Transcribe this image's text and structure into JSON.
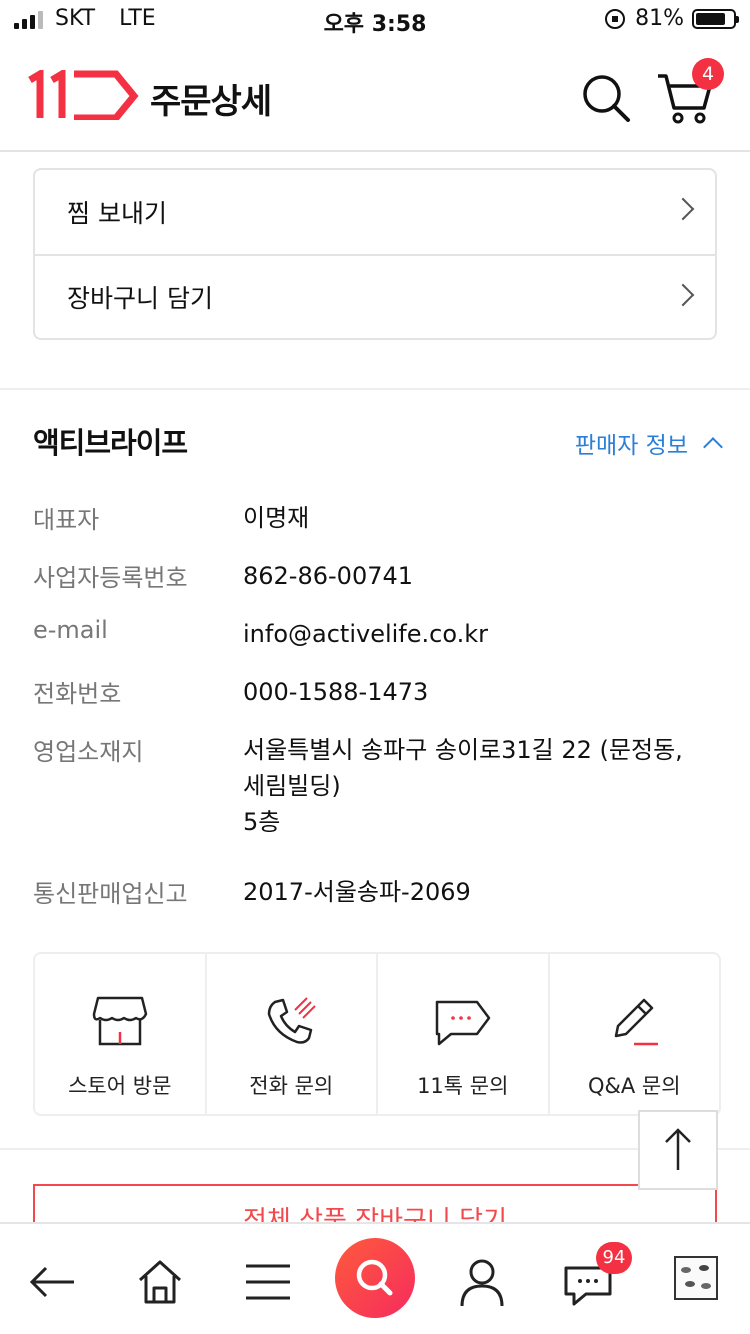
{
  "status_bar": {
    "carrier": "SKT",
    "network": "LTE",
    "time": "오후 3:58",
    "battery": "81%",
    "battery_level": 0.81
  },
  "header": {
    "title": "주문상세",
    "cart_count": "4",
    "brand_color": "#f43142"
  },
  "actions": [
    {
      "label": "찜 보내기"
    },
    {
      "label": "장바구니 담기"
    }
  ],
  "seller": {
    "name": "액티브라이프",
    "toggle_label": "판매자 정보",
    "fields": [
      {
        "label": "대표자",
        "value": "이명재"
      },
      {
        "label": "사업자등록번호",
        "value": "862-86-00741"
      },
      {
        "label": "e-mail",
        "value": "info@activelife.co.kr"
      },
      {
        "label": "전화번호",
        "value": "000-1588-1473"
      },
      {
        "label": "영업소재지",
        "value_lines": [
          "서울특별시 송파구 송이로31길 22 (문정동,",
          "세림빌딩)",
          "5층"
        ]
      },
      {
        "label": "통신판매업신고",
        "value": "2017-서울송파-2069"
      }
    ]
  },
  "contact": [
    {
      "label": "스토어 방문",
      "icon": "store-icon"
    },
    {
      "label": "전화 문의",
      "icon": "phone-icon"
    },
    {
      "label": "11톡 문의",
      "icon": "chat-icon"
    },
    {
      "label": "Q&A 문의",
      "icon": "pencil-icon"
    }
  ],
  "cta": {
    "label": "전체 상품 장바구니 담기"
  },
  "tabbar": {
    "talk_count": "94"
  }
}
